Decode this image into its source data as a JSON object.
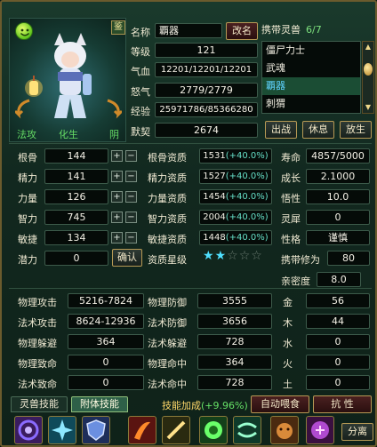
{
  "portrait": {
    "lock_glyph": "鉴",
    "status_left": "法攻",
    "status_mid": "化生",
    "status_right": "阴"
  },
  "info": {
    "name_label": "名称",
    "name_value": "覇器",
    "rename_button": "改名",
    "level_label": "等级",
    "level_value": "121",
    "hp_label": "气血",
    "hp_value": "12201/12201/12201",
    "mp_label": "怒气",
    "mp_value": "2779/2779",
    "exp_label": "经验",
    "exp_value": "25971786/85366280",
    "tacit_label": "默契",
    "tacit_value": "2674"
  },
  "carry": {
    "title": "携带灵兽",
    "count": "6/7",
    "items": [
      "僵尸力士",
      "武魂",
      "覇器",
      "刺猬"
    ],
    "selected_index": 2
  },
  "actions": {
    "battle": "出战",
    "rest": "休息",
    "release": "放生"
  },
  "base_attrs": [
    {
      "label": "根骨",
      "value": "144"
    },
    {
      "label": "精力",
      "value": "141"
    },
    {
      "label": "力量",
      "value": "126"
    },
    {
      "label": "智力",
      "value": "745"
    },
    {
      "label": "敏捷",
      "value": "134"
    }
  ],
  "potential": {
    "label": "潜力",
    "value": "0",
    "confirm": "确认"
  },
  "aptitudes": [
    {
      "label": "根骨资质",
      "value": "1531",
      "bonus": "(+40.0%)"
    },
    {
      "label": "精力资质",
      "value": "1527",
      "bonus": "(+40.0%)"
    },
    {
      "label": "力量资质",
      "value": "1454",
      "bonus": "(+40.0%)"
    },
    {
      "label": "智力资质",
      "value": "2004",
      "bonus": "(+40.0%)"
    },
    {
      "label": "敏捷资质",
      "value": "1448",
      "bonus": "(+40.0%)"
    }
  ],
  "star_rating": {
    "label": "资质星级",
    "filled": 2,
    "total": 5
  },
  "right_stats": [
    {
      "label": "寿命",
      "value": "4857/5000"
    },
    {
      "label": "成长",
      "value": "2.1000"
    },
    {
      "label": "悟性",
      "value": "10.0"
    },
    {
      "label": "灵犀",
      "value": "0"
    },
    {
      "label": "性格",
      "value": "谨慎"
    },
    {
      "label": "携带修为",
      "value": "80"
    }
  ],
  "intimacy": {
    "label": "亲密度",
    "value": "8.0"
  },
  "combat": {
    "left": [
      {
        "label": "物理攻击",
        "value": "5216-7824"
      },
      {
        "label": "法术攻击",
        "value": "8624-12936"
      },
      {
        "label": "物理躲避",
        "value": "364"
      },
      {
        "label": "物理致命",
        "value": "0"
      },
      {
        "label": "法术致命",
        "value": "0"
      }
    ],
    "mid": [
      {
        "label": "物理防御",
        "value": "3555"
      },
      {
        "label": "法术防御",
        "value": "3656"
      },
      {
        "label": "法术躲避",
        "value": "728"
      },
      {
        "label": "物理命中",
        "value": "364"
      },
      {
        "label": "法术命中",
        "value": "728"
      }
    ],
    "elements": [
      {
        "label": "金",
        "value": "56"
      },
      {
        "label": "木",
        "value": "44"
      },
      {
        "label": "水",
        "value": "0"
      },
      {
        "label": "火",
        "value": "0"
      },
      {
        "label": "土",
        "value": "0"
      }
    ]
  },
  "bottom": {
    "tab1": "灵兽技能",
    "tab2": "附体技能",
    "bonus_label": "技能加成",
    "bonus_value": "(+9.96%)",
    "auto_feed": "自动喂食",
    "resist": "抗 性",
    "separate": "分离"
  },
  "colors": {
    "accent_gold": "#b79a55",
    "selected_bg": "#1b4d34",
    "percent_teal": "#66e0c8"
  }
}
